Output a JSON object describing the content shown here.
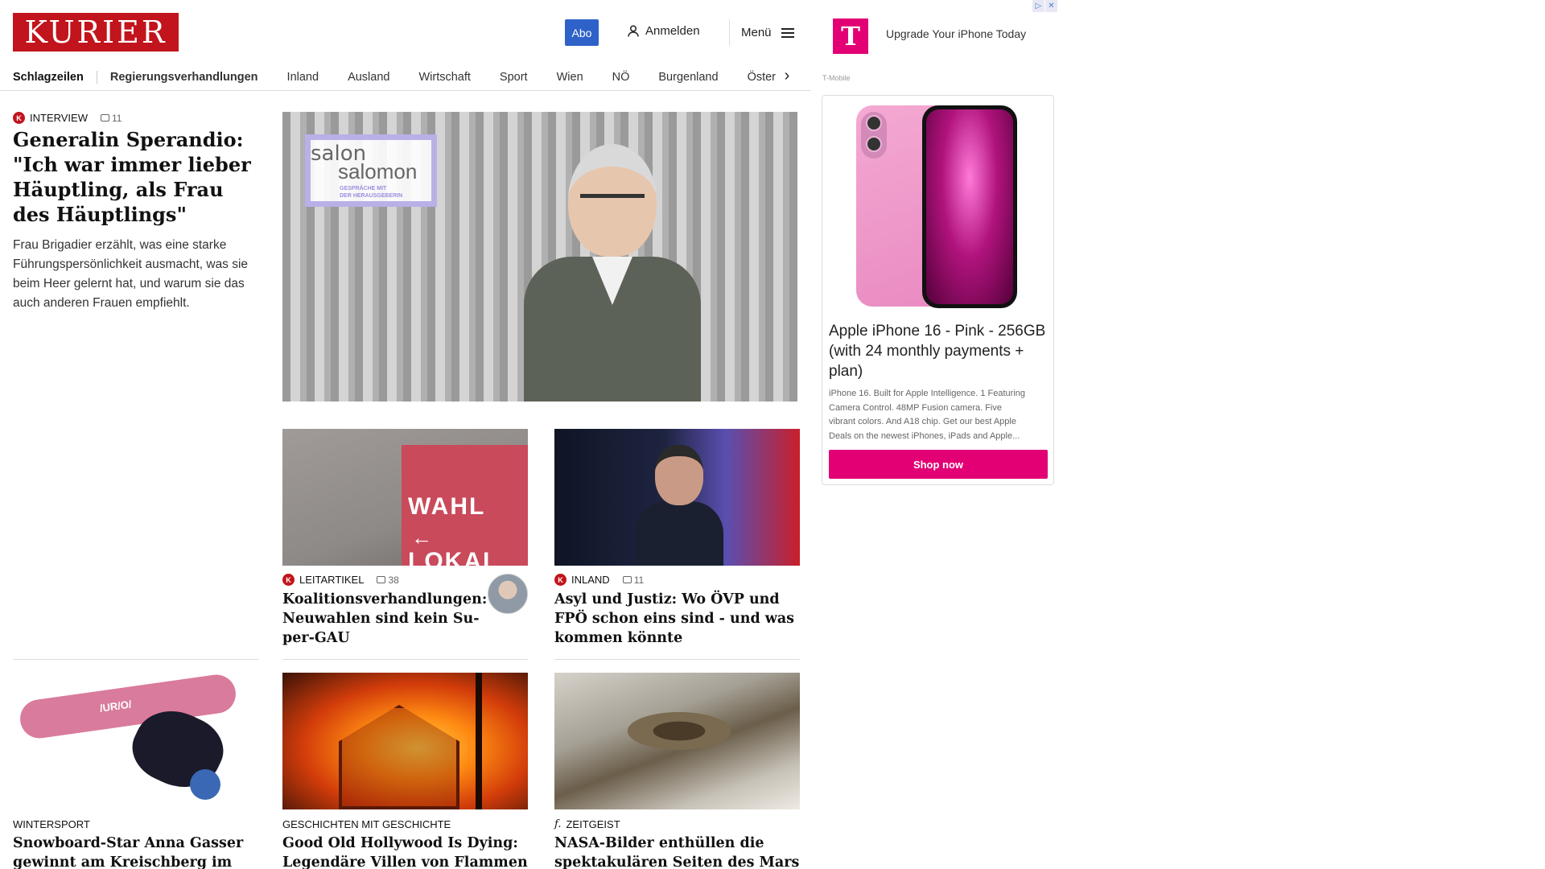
{
  "header": {
    "logo": "KURIER",
    "abo": "Abo",
    "login": "Anmelden",
    "menu": "Menü"
  },
  "nav": {
    "items": [
      "Schlagzeilen",
      "Regierungsverhandlungen",
      "Inland",
      "Ausland",
      "Wirtschaft",
      "Sport",
      "Wien",
      "NÖ",
      "Burgenland",
      "Öster"
    ]
  },
  "lead": {
    "kicker": "INTERVIEW",
    "comments": "11",
    "title": "Generalin Sperandio: \"Ich war immer lieber Häupt­ling, als Frau des Häuptlings\"",
    "subtitle": "Frau Brigadier erzählt, was eine starke Führungspersönlichkeit ausmacht, was sie beim Heer gelernt hat, und warum sie das auch anderen Frauen empfiehlt.",
    "badge_line1": "salon",
    "badge_line2": "salomon",
    "badge_line3": "GESPRÄCHE MIT",
    "badge_line4": "DER HERAUSGEBERIN"
  },
  "cards": [
    {
      "kicker": "LEITARTIKEL",
      "comments": "38",
      "title": "Koalitionsverhandlungen: Neuwahlen sind kein Su­per-GAU",
      "sign_top": "WAHL",
      "sign_arrow": "←",
      "sign_bottom": "LOKAL"
    },
    {
      "kicker": "INLAND",
      "comments": "11",
      "title": "Asyl und Justiz: Wo ÖVP und FPÖ schon eins sind - und was kommen könnte"
    },
    {
      "kicker": "WINTERSPORT",
      "title": "Snowboard-Star Anna Gasser ge­winnt am Kreischberg im Big-Air",
      "board_text": "/UR/O/"
    },
    {
      "kicker": "GESCHICHTEN MIT GESCHICHTE",
      "title": "Good Old Hollywood Is Dying: Le­gendäre Villen von Flammen bedroht"
    },
    {
      "kicker": "ZEITGEIST",
      "kicker_icon": "f.",
      "title": "NASA-Bilder enthüllen die spekta­kulären Seiten des Mars"
    }
  ],
  "ad": {
    "headline": "Upgrade Your iPhone Today",
    "brand": "T-Mobile",
    "logo_letter": "T",
    "chip1": "▷",
    "chip2": "✕",
    "title": "Apple iPhone 16 - Pink - 256GB (with 24 monthly payments + plan)",
    "description": "iPhone 16. Built for Apple Intelligence. 1 Featuring\nCamera Control. 48MP Fusion camera. Five\nvibrant colors. And A18 chip. Get our best Apple\nDeals on the newest iPhones, iPads and Apple...",
    "cta": "Shop now",
    "brand_color": "#e20074"
  },
  "colors": {
    "kurier_red": "#c2141c",
    "abo_blue": "#2e62c9"
  }
}
